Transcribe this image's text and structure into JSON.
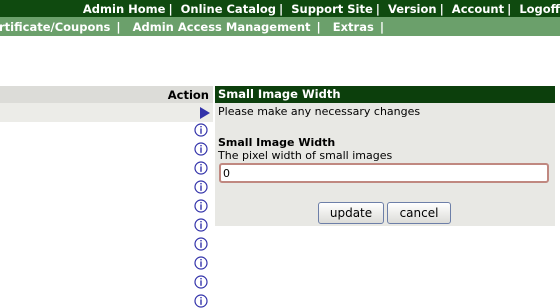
{
  "topnav": {
    "items": [
      "Admin Home",
      "Online Catalog",
      "Support Site",
      "Version",
      "Account",
      "Logoff"
    ],
    "separator": "|"
  },
  "subnav": {
    "items": [
      "rtificate/Coupons",
      "Admin Access Management",
      "Extras"
    ],
    "separator": "|"
  },
  "left_table": {
    "header": "Action",
    "selected_row_icon": "right-arrow-icon",
    "row_icon": "info-circle-icon"
  },
  "edit_panel": {
    "title": "Small Image Width",
    "intro": "Please make any necessary changes",
    "field_label": "Small Image Width",
    "field_description": "The pixel width of small images",
    "field_value": "0",
    "update_label": "update",
    "cancel_label": "cancel"
  },
  "colors": {
    "topbar": "#0f4a0f",
    "subbar": "#6ba06b",
    "panel_header": "#0c3f0c",
    "panel_body": "#e8e8e4",
    "arrow": "#3333aa",
    "info_icon": "#3333aa"
  }
}
